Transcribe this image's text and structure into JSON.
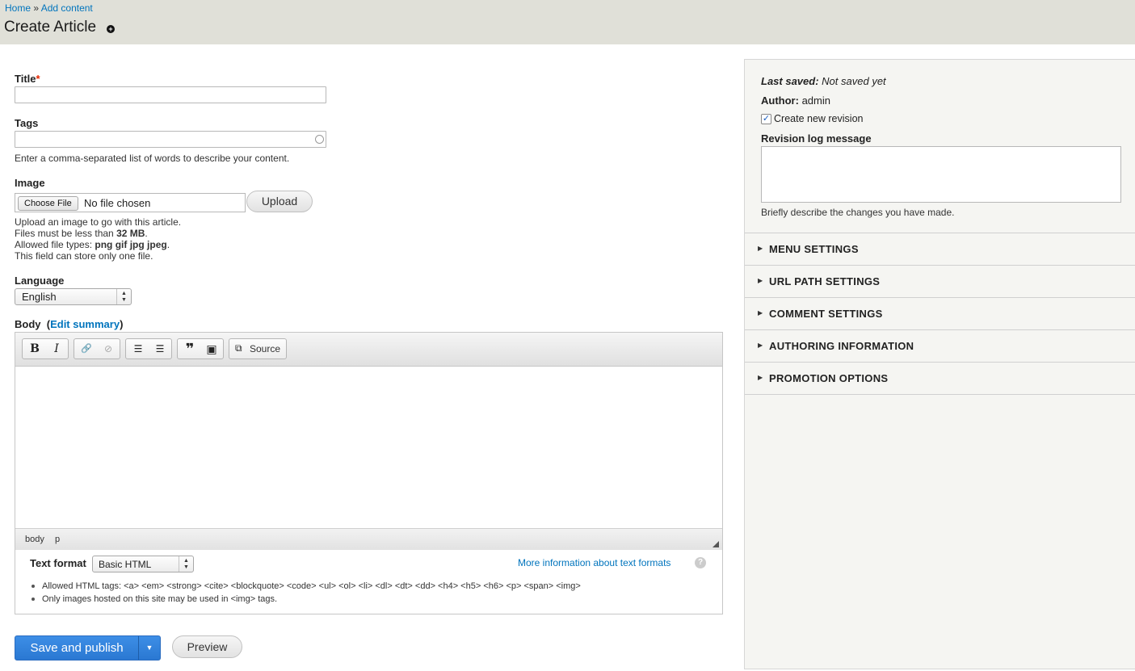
{
  "breadcrumb": {
    "home": "Home",
    "separator": "»",
    "current": "Add content"
  },
  "page_title": "Create Article",
  "shortcut_icon": "+",
  "fields": {
    "title": {
      "label": "Title",
      "required_mark": "*",
      "value": ""
    },
    "tags": {
      "label": "Tags",
      "value": "",
      "description": "Enter a comma-separated list of words to describe your content."
    },
    "image": {
      "label": "Image",
      "choose_button": "Choose File",
      "file_status": "No file chosen",
      "upload_button": "Upload",
      "help_line1": "Upload an image to go with this article.",
      "help_line2_prefix": "Files must be less than ",
      "help_line2_value": "32 MB",
      "help_line2_suffix": ".",
      "help_line3_prefix": "Allowed file types: ",
      "help_line3_value": "png gif jpg jpeg",
      "help_line3_suffix": ".",
      "help_line4": "This field can store only one file."
    },
    "language": {
      "label": "Language",
      "selected": "English"
    },
    "body": {
      "label": "Body",
      "edit_summary_open": "(",
      "edit_summary": "Edit summary",
      "edit_summary_close": ")"
    }
  },
  "editor": {
    "toolbar": {
      "bold": "B",
      "italic": "I",
      "link": "🔗",
      "unlink": "⊘",
      "bulleted_list": "☰",
      "numbered_list": "☰",
      "blockquote": "❞",
      "image": "▣",
      "source_icon": "⧉",
      "source": "Source"
    },
    "path": [
      "body",
      "p"
    ]
  },
  "text_format": {
    "label": "Text format",
    "selected": "Basic HTML",
    "more_info": "More information about text formats",
    "help_icon": "?",
    "tips": [
      "Allowed HTML tags: <a> <em> <strong> <cite> <blockquote> <code> <ul> <ol> <li> <dl> <dt> <dd> <h4> <h5> <h6> <p> <span> <img>",
      "Only images hosted on this site may be used in <img> tags."
    ]
  },
  "actions": {
    "save": "Save and publish",
    "dropdown": "▼",
    "preview": "Preview"
  },
  "sidebar": {
    "last_saved_label": "Last saved:",
    "last_saved_value": "Not saved yet",
    "author_label": "Author:",
    "author_value": "admin",
    "create_revision": {
      "label": "Create new revision",
      "checked": true,
      "check_mark": "✓"
    },
    "revision_log": {
      "label": "Revision log message",
      "value": "",
      "description": "Briefly describe the changes you have made."
    },
    "sections": [
      "MENU SETTINGS",
      "URL PATH SETTINGS",
      "COMMENT SETTINGS",
      "AUTHORING INFORMATION",
      "PROMOTION OPTIONS"
    ],
    "section_arrow": "▶"
  },
  "colors": {
    "link": "#0074bd",
    "primary": "#2a78d2",
    "header_bg": "#e0e0d8",
    "sidebar_bg": "#f5f5f2"
  }
}
